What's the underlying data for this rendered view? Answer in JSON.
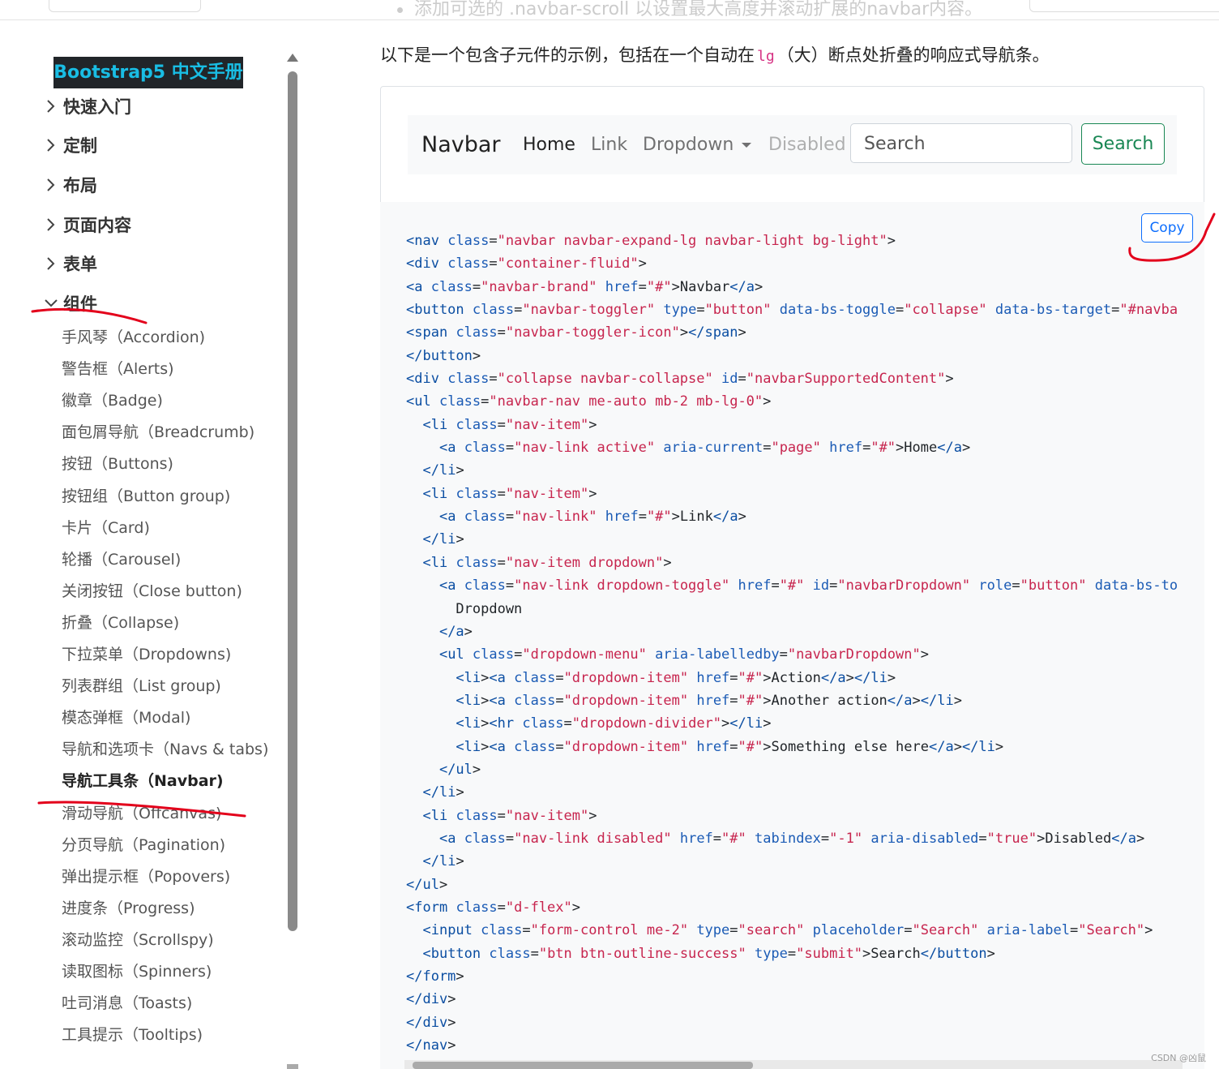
{
  "topbar": {
    "faded_text": "添加可选的 .navbar-scroll 以设置最大高度并滚动扩展的navbar内容。"
  },
  "sidebar": {
    "brand": "Bootstrap5 中文手册",
    "sections": [
      {
        "label": "快速入门",
        "expanded": false
      },
      {
        "label": "定制",
        "expanded": false
      },
      {
        "label": "布局",
        "expanded": false
      },
      {
        "label": "页面内容",
        "expanded": false
      },
      {
        "label": "表单",
        "expanded": false
      },
      {
        "label": "组件",
        "expanded": true
      }
    ],
    "items": [
      "手风琴（Accordion)",
      "警告框（Alerts)",
      "徽章（Badge)",
      "面包屑导航（Breadcrumb)",
      "按钮（Buttons)",
      "按钮组（Button group)",
      "卡片（Card)",
      "轮播（Carousel)",
      "关闭按钮（Close button)",
      "折叠（Collapse)",
      "下拉菜单（Dropdowns)",
      "列表群组（List group)",
      "模态弹框（Modal)",
      "导航和选项卡（Navs & tabs)",
      "导航工具条（Navbar)",
      "滑动导航（Offcanvas)",
      "分页导航（Pagination)",
      "弹出提示框（Popovers)",
      "进度条（Progress)",
      "滚动监控（Scrollspy)",
      "读取图标（Spinners)",
      "吐司消息（Toasts)",
      "工具提示（Tooltips)"
    ],
    "active_item": "导航工具条（Navbar)"
  },
  "main": {
    "intro_before": "以下是一个包含子元件的示例，包括在一个自动在",
    "intro_code": "lg",
    "intro_after": "（大）断点处折叠的响应式导航条。",
    "example": {
      "brand": "Navbar",
      "links": [
        "Home",
        "Link",
        "Dropdown",
        "Disabled"
      ],
      "search_placeholder": "Search",
      "search_button": "Search"
    },
    "copy_label": "Copy"
  },
  "code_lines": [
    "<nav class=\"navbar navbar-expand-lg navbar-light bg-light\">",
    "<div class=\"container-fluid\">",
    "<a class=\"navbar-brand\" href=\"#\">Navbar</a>",
    "<button class=\"navbar-toggler\" type=\"button\" data-bs-toggle=\"collapse\" data-bs-target=\"#navbarSupportedContent\"",
    "<span class=\"navbar-toggler-icon\"></span>",
    "</button>",
    "<div class=\"collapse navbar-collapse\" id=\"navbarSupportedContent\">",
    "<ul class=\"navbar-nav me-auto mb-2 mb-lg-0\">",
    "  <li class=\"nav-item\">",
    "    <a class=\"nav-link active\" aria-current=\"page\" href=\"#\">Home</a>",
    "  </li>",
    "  <li class=\"nav-item\">",
    "    <a class=\"nav-link\" href=\"#\">Link</a>",
    "  </li>",
    "  <li class=\"nav-item dropdown\">",
    "    <a class=\"nav-link dropdown-toggle\" href=\"#\" id=\"navbarDropdown\" role=\"button\" data-bs-toggle=\"dropdown\"",
    "      Dropdown",
    "    </a>",
    "    <ul class=\"dropdown-menu\" aria-labelledby=\"navbarDropdown\">",
    "      <li><a class=\"dropdown-item\" href=\"#\">Action</a></li>",
    "      <li><a class=\"dropdown-item\" href=\"#\">Another action</a></li>",
    "      <li><hr class=\"dropdown-divider\"></li>",
    "      <li><a class=\"dropdown-item\" href=\"#\">Something else here</a></li>",
    "    </ul>",
    "  </li>",
    "  <li class=\"nav-item\">",
    "    <a class=\"nav-link disabled\" href=\"#\" tabindex=\"-1\" aria-disabled=\"true\">Disabled</a>",
    "  </li>",
    "</ul>",
    "<form class=\"d-flex\">",
    "  <input class=\"form-control me-2\" type=\"search\" placeholder=\"Search\" aria-label=\"Search\">",
    "  <button class=\"btn btn-outline-success\" type=\"submit\">Search</button>",
    "</form>",
    "</div>",
    "</div>",
    "</nav>"
  ],
  "watermark": "CSDN @凶鼠",
  "colors": {
    "brand_bg": "#212529",
    "brand_fg": "#19bde4",
    "annotation": "#e3001b",
    "success": "#198754",
    "primary": "#0d6efd"
  }
}
